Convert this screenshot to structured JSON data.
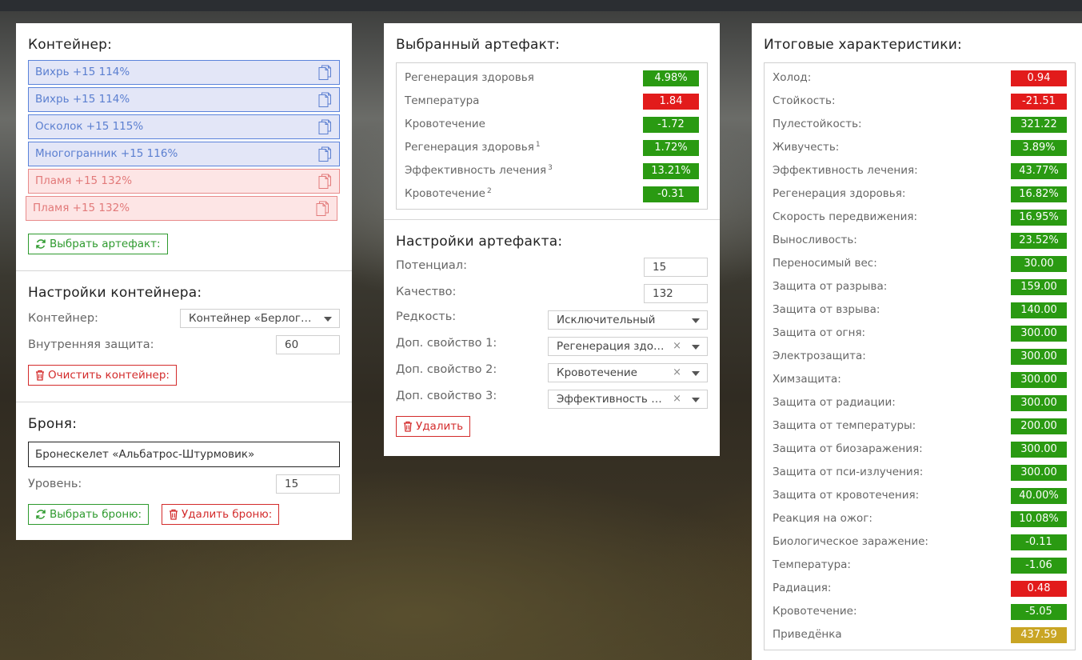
{
  "container_panel": {
    "title": "Контейнер:",
    "slots": [
      {
        "label": "Вихрь +15 114%",
        "kind": "blue"
      },
      {
        "label": "Вихрь +15 114%",
        "kind": "blue"
      },
      {
        "label": "Осколок +15 115%",
        "kind": "blue"
      },
      {
        "label": "Многогранник +15 116%",
        "kind": "blue"
      },
      {
        "label": "Пламя +15 132%",
        "kind": "red"
      },
      {
        "label": "Пламя +15 132%",
        "kind": "red"
      }
    ],
    "select_artifact_button": "Выбрать артефакт:"
  },
  "container_settings": {
    "title": "Настройки контейнера:",
    "container_label": "Контейнер:",
    "container_value": "Контейнер «Берлога...",
    "inner_protection_label": "Внутренняя защита:",
    "inner_protection_value": "60",
    "clear_button": "Очистить контейнер:"
  },
  "armor": {
    "title": "Броня:",
    "armor_name": "Бронескелет «Альбатрос-Штурмовик»",
    "level_label": "Уровень:",
    "level_value": "15",
    "select_button": "Выбрать броню:",
    "delete_button": "Удалить броню:"
  },
  "selected_artifact": {
    "title": "Выбранный артефакт:",
    "stats": [
      {
        "label": "Регенерация здоровья",
        "sup": "",
        "value": "4.98%",
        "color": "green"
      },
      {
        "label": "Температура",
        "sup": "",
        "value": "1.84",
        "color": "red"
      },
      {
        "label": "Кровотечение",
        "sup": "",
        "value": "-1.72",
        "color": "green"
      },
      {
        "label": "Регенерация здоровья",
        "sup": "1",
        "value": "1.72%",
        "color": "green"
      },
      {
        "label": "Эффективность лечения",
        "sup": "3",
        "value": "13.21%",
        "color": "green"
      },
      {
        "label": "Кровотечение",
        "sup": "2",
        "value": "-0.31",
        "color": "green"
      }
    ]
  },
  "artifact_settings": {
    "title": "Настройки артефакта:",
    "potential_label": "Потенциал:",
    "potential_value": "15",
    "quality_label": "Качество:",
    "quality_value": "132",
    "rarity_label": "Редкость:",
    "rarity_value": "Исключительный",
    "extra1_label": "Доп. свойство 1:",
    "extra1_value": "Регенерация здор...",
    "extra2_label": "Доп. свойство 2:",
    "extra2_value": "Кровотечение",
    "extra3_label": "Доп. свойство 3:",
    "extra3_value": "Эффективность ле...",
    "clear_symbol": "×",
    "delete_button": "Удалить"
  },
  "totals": {
    "title": "Итоговые характеристики:",
    "stats": [
      {
        "label": "Холод:",
        "value": "0.94",
        "color": "red"
      },
      {
        "label": "Стойкость:",
        "value": "-21.51",
        "color": "red"
      },
      {
        "label": "Пулестойкость:",
        "value": "321.22",
        "color": "green"
      },
      {
        "label": "Живучесть:",
        "value": "3.89%",
        "color": "green"
      },
      {
        "label": "Эффективность лечения:",
        "value": "43.77%",
        "color": "green"
      },
      {
        "label": "Регенерация здоровья:",
        "value": "16.82%",
        "color": "green"
      },
      {
        "label": "Скорость передвижения:",
        "value": "16.95%",
        "color": "green"
      },
      {
        "label": "Выносливость:",
        "value": "23.52%",
        "color": "green"
      },
      {
        "label": "Переносимый вес:",
        "value": "30.00",
        "color": "green"
      },
      {
        "label": "Защита от разрыва:",
        "value": "159.00",
        "color": "green"
      },
      {
        "label": "Защита от взрыва:",
        "value": "140.00",
        "color": "green"
      },
      {
        "label": "Защита от огня:",
        "value": "300.00",
        "color": "green"
      },
      {
        "label": "Электрозащита:",
        "value": "300.00",
        "color": "green"
      },
      {
        "label": "Химзащита:",
        "value": "300.00",
        "color": "green"
      },
      {
        "label": "Защита от радиации:",
        "value": "300.00",
        "color": "green"
      },
      {
        "label": "Защита от температуры:",
        "value": "200.00",
        "color": "green"
      },
      {
        "label": "Защита от биозаражения:",
        "value": "300.00",
        "color": "green"
      },
      {
        "label": "Защита от пси-излучения:",
        "value": "300.00",
        "color": "green"
      },
      {
        "label": "Защита от кровотечения:",
        "value": "40.00%",
        "color": "green"
      },
      {
        "label": "Реакция на ожог:",
        "value": "10.08%",
        "color": "green"
      },
      {
        "label": "Биологическое заражение:",
        "value": "-0.11",
        "color": "green"
      },
      {
        "label": "Температура:",
        "value": "-1.06",
        "color": "green"
      },
      {
        "label": "Радиация:",
        "value": "0.48",
        "color": "red"
      },
      {
        "label": "Кровотечение:",
        "value": "-5.05",
        "color": "green"
      },
      {
        "label": "Приведёнка",
        "value": "437.59",
        "color": "gold"
      }
    ]
  },
  "icons": {
    "copy": "copy-icon",
    "refresh": "refresh-icon",
    "trash": "trash-icon",
    "caret": "chevron-down-icon"
  }
}
